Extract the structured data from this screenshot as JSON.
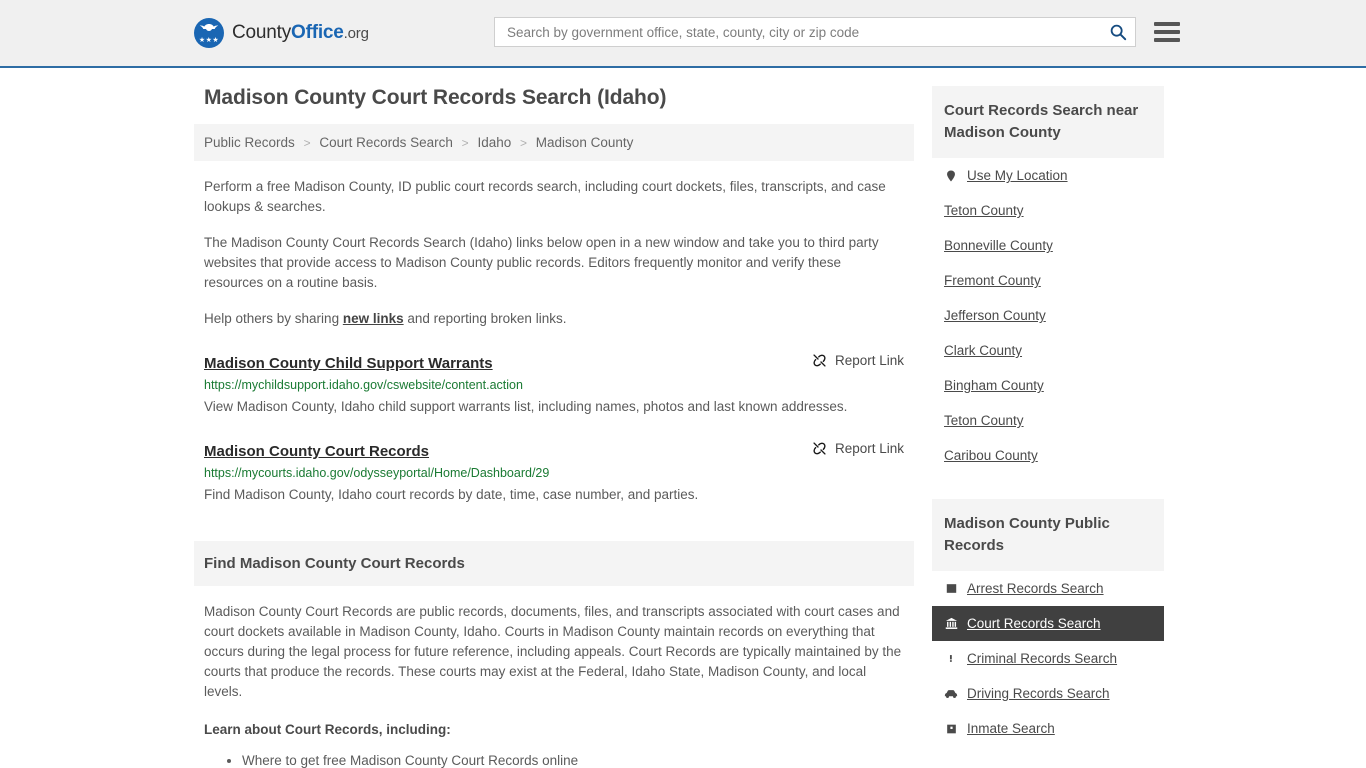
{
  "header": {
    "logo": {
      "part1": "County",
      "part2": "Office",
      "part3": ".org",
      "icon": "eagle-shield-logo",
      "stars": "★★★"
    },
    "search": {
      "placeholder": "Search by government office, state, county, city or zip code",
      "value": "",
      "icon": "search-icon"
    },
    "menu_icon": "hamburger-menu-icon",
    "accent_color": "#2e6da4"
  },
  "main": {
    "title": "Madison County Court Records Search (Idaho)",
    "breadcrumb": [
      "Public Records",
      "Court Records Search",
      "Idaho",
      "Madison County"
    ],
    "breadcrumb_separator": ">",
    "intro": {
      "p1": "Perform a free Madison County, ID public court records search, including court dockets, files, transcripts, and case lookups & searches.",
      "p2": "The Madison County Court Records Search (Idaho) links below open in a new window and take you to third party websites that provide access to Madison County public records. Editors frequently monitor and verify these resources on a routine basis.",
      "p3_before": "Help others by sharing ",
      "p3_link": "new links",
      "p3_after": " and reporting broken links."
    },
    "results": [
      {
        "title": "Madison County Child Support Warrants",
        "url": "https://mychildsupport.idaho.gov/cswebsite/content.action",
        "description": "View Madison County, Idaho child support warrants list, including names, photos and last known addresses.",
        "report_label": "Report Link",
        "report_icon": "unlink-icon"
      },
      {
        "title": "Madison County Court Records",
        "url": "https://mycourts.idaho.gov/odysseyportal/Home/Dashboard/29",
        "description": "Find Madison County, Idaho court records by date, time, case number, and parties.",
        "report_label": "Report Link",
        "report_icon": "unlink-icon"
      }
    ],
    "section": {
      "heading": "Find Madison County Court Records",
      "body": "Madison County Court Records are public records, documents, files, and transcripts associated with court cases and court dockets available in Madison County, Idaho. Courts in Madison County maintain records on everything that occurs during the legal process for future reference, including appeals. Court Records are typically maintained by the courts that produce the records. These courts may exist at the Federal, Idaho State, Madison County, and local levels.",
      "learn_heading": "Learn about Court Records, including:",
      "bullets": [
        "Where to get free Madison County Court Records online"
      ]
    },
    "url_color": "#1a7a33"
  },
  "sidebar": {
    "nearby": {
      "heading": "Court Records Search near Madison County",
      "items": [
        {
          "label": "Use My Location",
          "icon": "map-pin-icon"
        },
        {
          "label": "Teton County",
          "icon": ""
        },
        {
          "label": "Bonneville County",
          "icon": ""
        },
        {
          "label": "Fremont County",
          "icon": ""
        },
        {
          "label": "Jefferson County",
          "icon": ""
        },
        {
          "label": "Clark County",
          "icon": ""
        },
        {
          "label": "Bingham County",
          "icon": ""
        },
        {
          "label": "Teton County",
          "icon": ""
        },
        {
          "label": "Caribou County",
          "icon": ""
        }
      ]
    },
    "public_records": {
      "heading": "Madison County Public Records",
      "items": [
        {
          "label": "Arrest Records Search",
          "icon": "fingerprint-icon",
          "active": false
        },
        {
          "label": "Court Records Search",
          "icon": "courthouse-icon",
          "active": true
        },
        {
          "label": "Criminal Records Search",
          "icon": "exclamation-icon",
          "active": false
        },
        {
          "label": "Driving Records Search",
          "icon": "car-icon",
          "active": false
        },
        {
          "label": "Inmate Search",
          "icon": "jail-icon",
          "active": false
        }
      ],
      "active_bg": "#404040"
    }
  }
}
